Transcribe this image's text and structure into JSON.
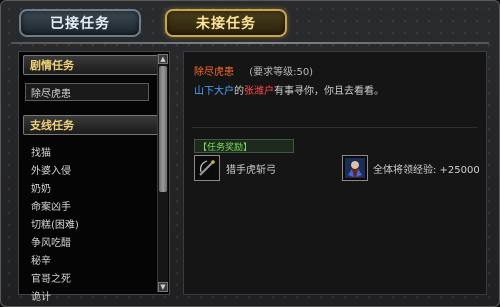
{
  "tabs": {
    "accepted": "已接任务",
    "unaccepted": "未接任务"
  },
  "left": {
    "plot_header": "剧情任务",
    "plot_items": [
      "除尽虎患"
    ],
    "branch_header": "支线任务",
    "branch_items": [
      "找猫",
      "外婆入侵",
      "奶奶",
      "命案凶手",
      "切糕(困难)",
      "争风吃醋",
      "秘辛",
      "官哥之死",
      "诡计"
    ]
  },
  "quest": {
    "name": "除尽虎患",
    "level": "(要求等级:50)",
    "desc": {
      "part1": "山下大户",
      "part2": "的",
      "part3": "张潍户",
      "part4": "有事寻你，你且去看看。"
    }
  },
  "reward": {
    "header": "【任务奖励】",
    "item1": "猎手虎斩弓",
    "item2": "全体将领经验: +25000"
  },
  "colors": {
    "quest_name": "#ff6a2a",
    "highlight_blue": "#4aa3ff",
    "highlight_red": "#ff4a4a",
    "reward_header": "#78e05a",
    "section_header": "#f0d27a",
    "active_tab": "#ffe39a"
  },
  "icons": {
    "reward1": "bow-icon",
    "reward2": "hero-portrait-icon",
    "scroll_up": "arrow-up-icon",
    "scroll_down": "arrow-down-icon"
  }
}
